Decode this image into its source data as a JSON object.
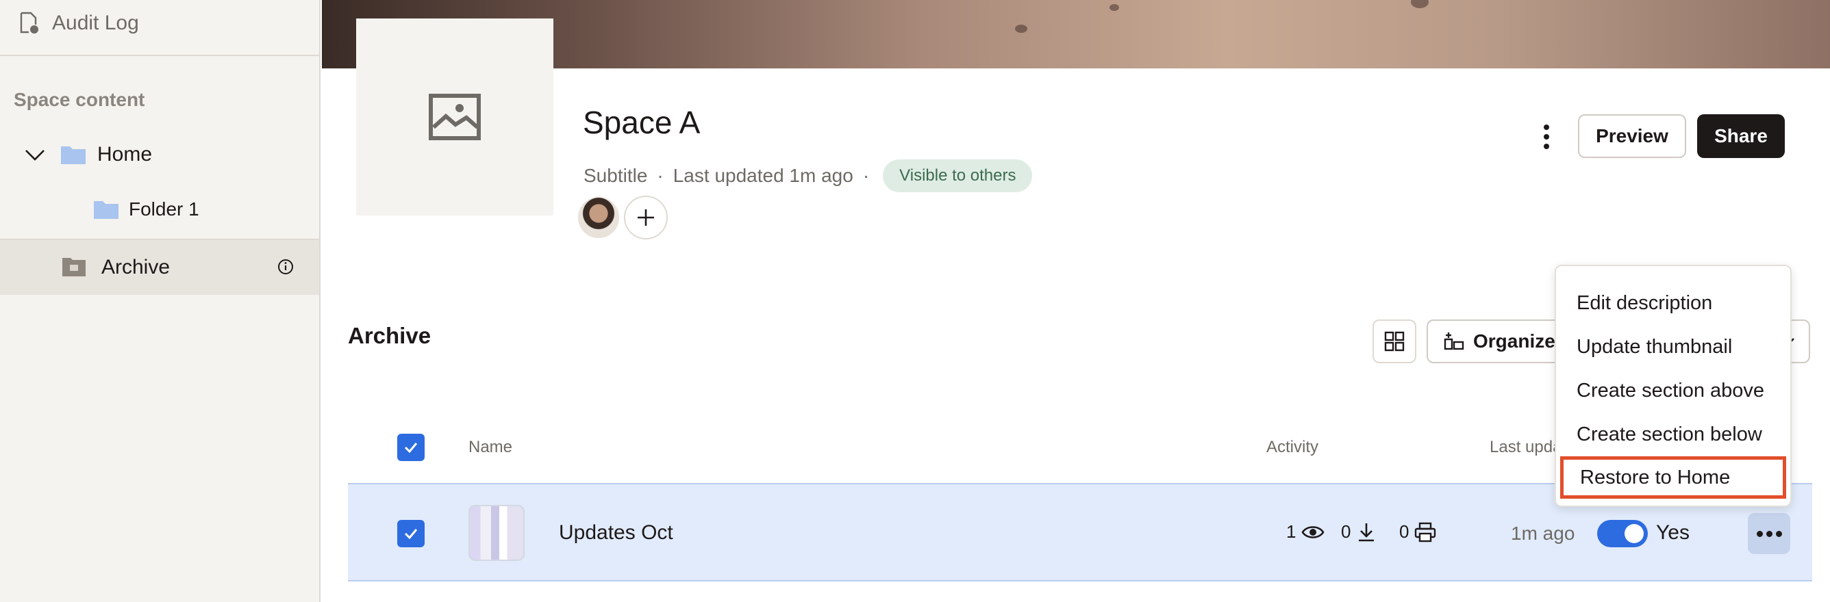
{
  "sidebar": {
    "audit_log": "Audit Log",
    "section_label": "Space content",
    "items": [
      {
        "label": "Home"
      },
      {
        "label": "Folder 1"
      },
      {
        "label": "Archive"
      }
    ]
  },
  "space": {
    "title": "Space A",
    "subtitle": "Subtitle",
    "separator": "·",
    "last_updated": "Last updated 1m ago",
    "visibility": "Visible to others"
  },
  "header_actions": {
    "preview": "Preview",
    "share": "Share"
  },
  "section": {
    "title": "Archive",
    "organize_label": "Organize"
  },
  "table": {
    "columns": [
      "Name",
      "Activity",
      "Last upda"
    ],
    "rows": [
      {
        "name": "Updates Oct",
        "views": "1",
        "downloads": "0",
        "prints": "0",
        "last_updated": "1m ago",
        "toggle_label": "Yes",
        "selected": true
      }
    ]
  },
  "context_menu": {
    "items": [
      "Edit description",
      "Update thumbnail",
      "Create section above",
      "Create section below",
      "Restore to Home"
    ],
    "highlighted": "Restore to Home"
  },
  "colors": {
    "accent_blue": "#2d6be0",
    "highlight_border": "#e14f2c",
    "selected_row": "#e1ebfb",
    "pill_bg": "#dfece4"
  }
}
